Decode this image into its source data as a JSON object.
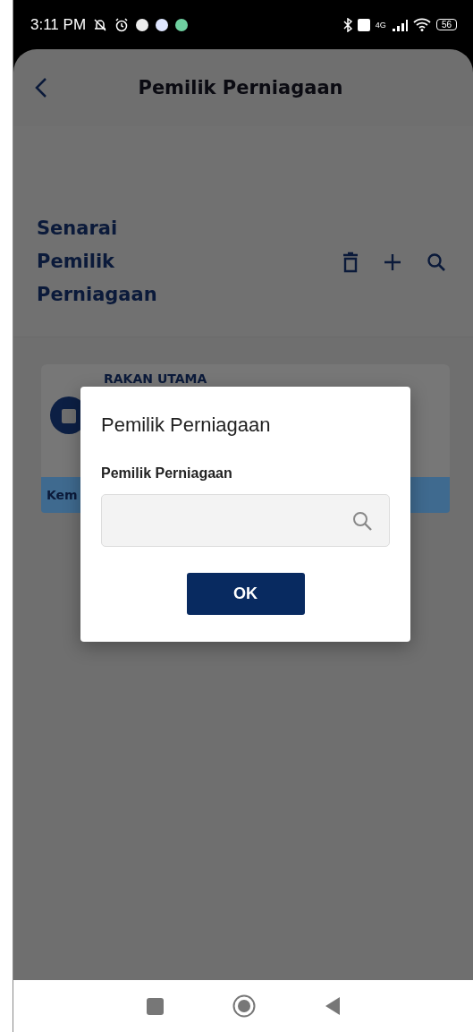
{
  "status_bar": {
    "time": "3:11 PM",
    "network": "4G",
    "battery": "56"
  },
  "app_bar": {
    "title": "Pemilik Perniagaan"
  },
  "section": {
    "title": "Senarai Pemilik Perniagaan"
  },
  "card": {
    "name": "RAKAN UTAMA",
    "footer": "Kem"
  },
  "dialog": {
    "title": "Pemilik Perniagaan",
    "field_label": "Pemilik Perniagaan",
    "button": "OK"
  }
}
